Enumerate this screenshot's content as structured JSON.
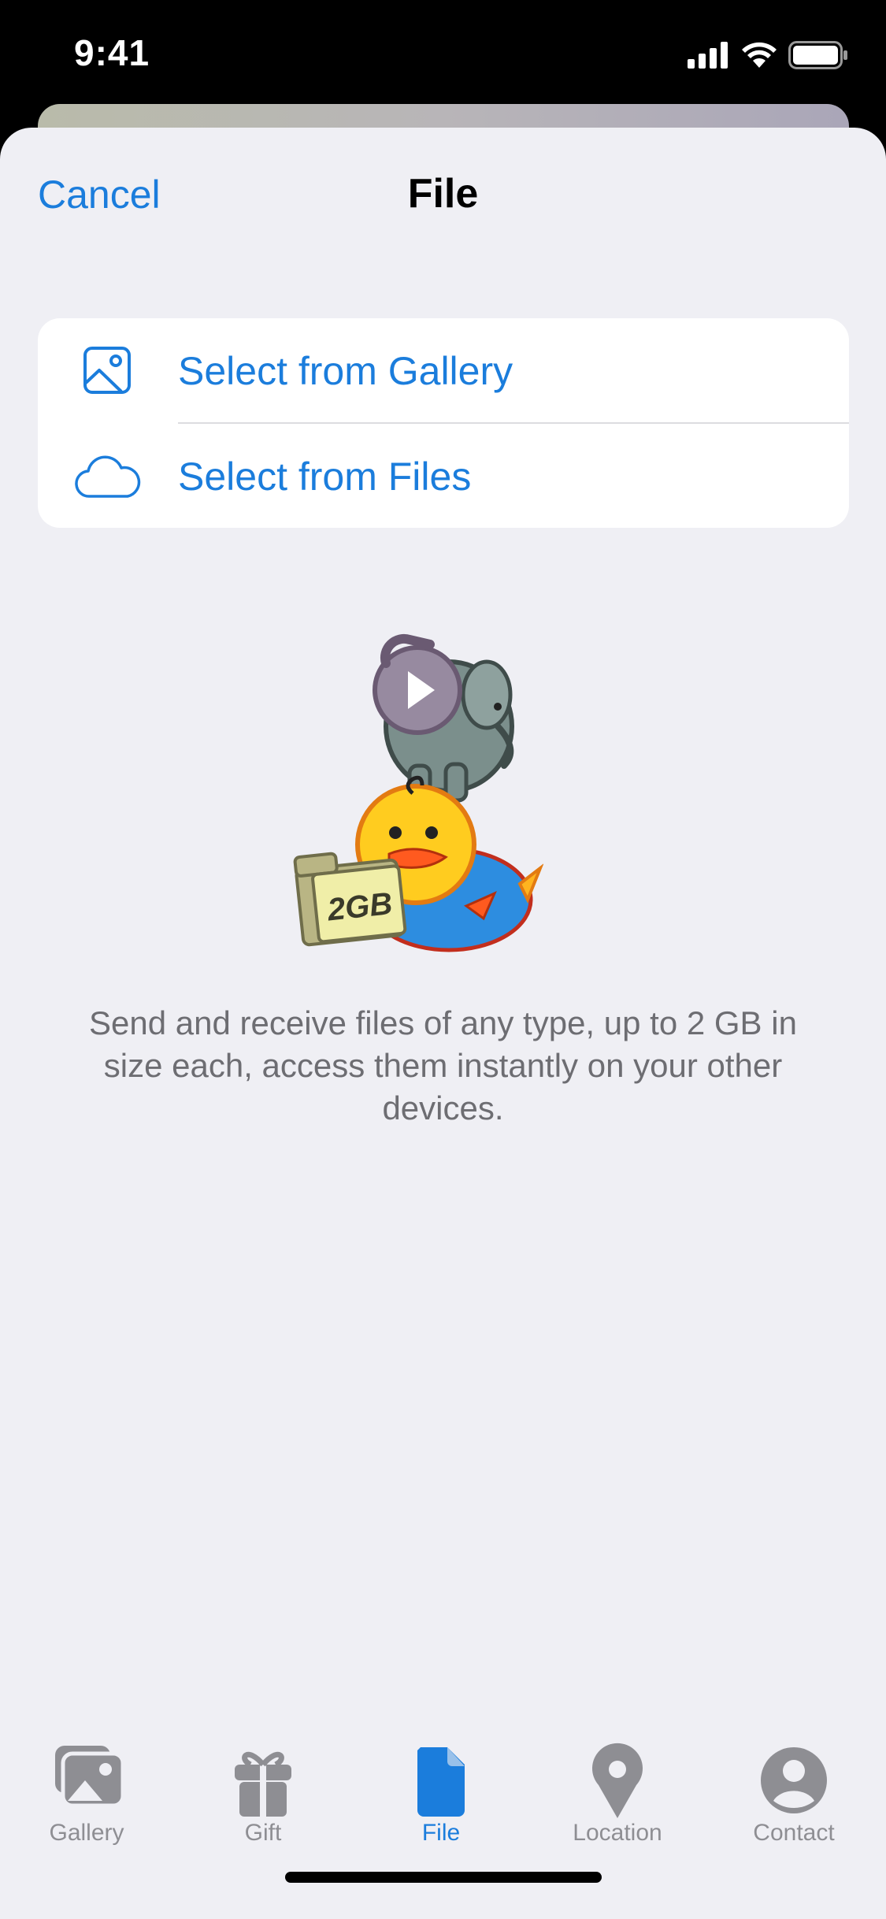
{
  "status_bar": {
    "time": "9:41"
  },
  "header": {
    "cancel_label": "Cancel",
    "title": "File"
  },
  "actions": [
    {
      "label": "Select from Gallery",
      "icon": "gallery-icon"
    },
    {
      "label": "Select from Files",
      "icon": "cloud-icon"
    }
  ],
  "illustration": {
    "folder_label": "2GB"
  },
  "description": "Send and receive files of any type, up to 2 GB in size each, access them instantly on your other devices.",
  "tabs": [
    {
      "label": "Gallery",
      "icon": "gallery-tab-icon",
      "active": false
    },
    {
      "label": "Gift",
      "icon": "gift-icon",
      "active": false
    },
    {
      "label": "File",
      "icon": "file-icon",
      "active": true
    },
    {
      "label": "Location",
      "icon": "location-pin-icon",
      "active": false
    },
    {
      "label": "Contact",
      "icon": "contact-icon",
      "active": false
    }
  ],
  "colors": {
    "accent": "#1b7ddc",
    "background": "#efeff4",
    "inactive": "#8e8e93"
  }
}
